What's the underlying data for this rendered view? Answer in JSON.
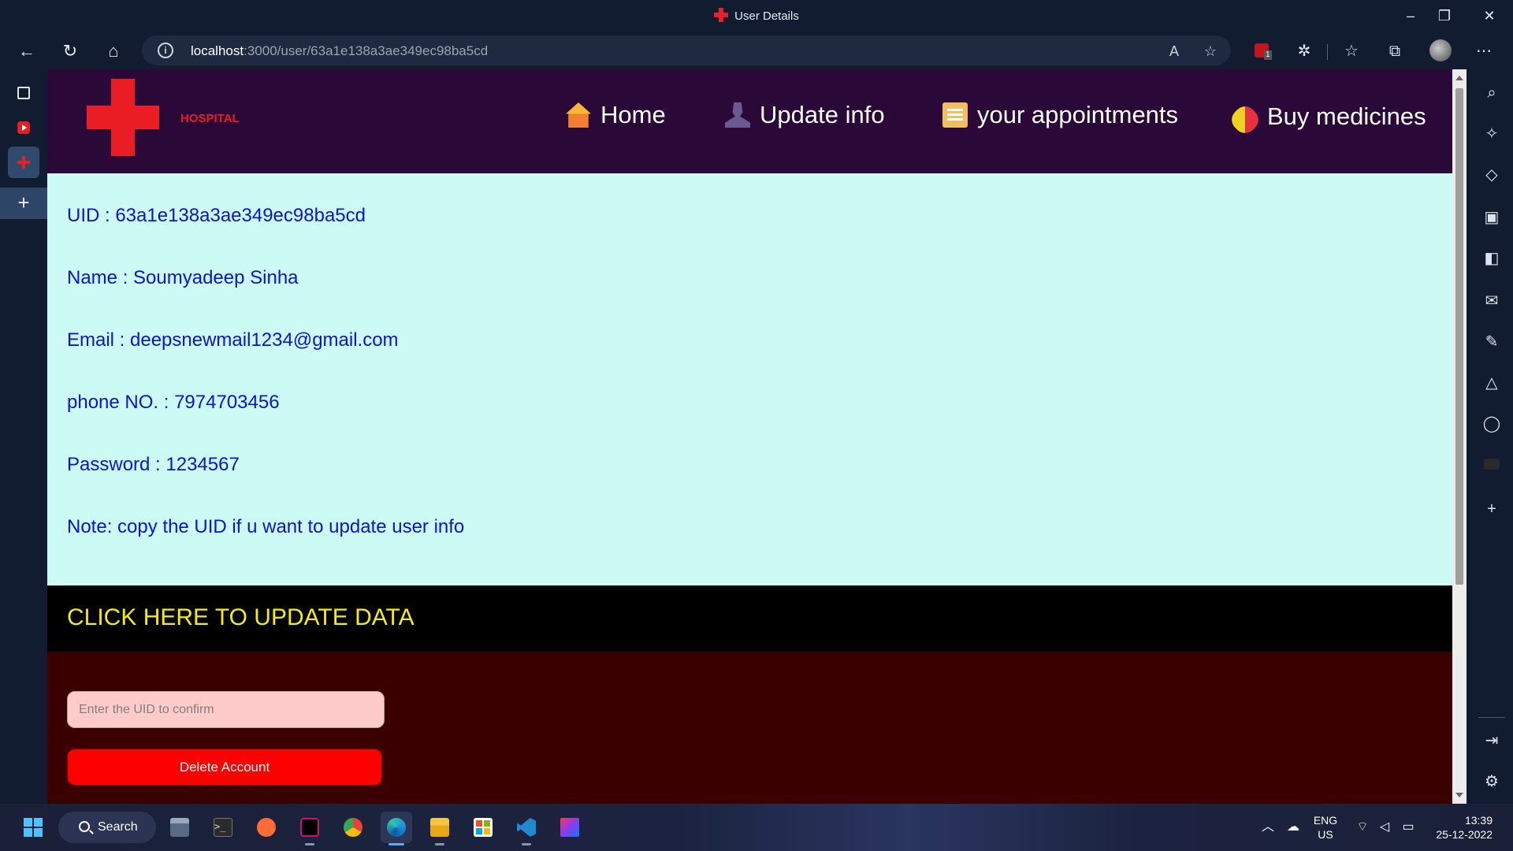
{
  "browser": {
    "tab_title": "User Details",
    "url_host": "localhost",
    "url_path": ":3000/user/63a1e138a3ae349ec98ba5cd"
  },
  "site": {
    "logo_text": "HOSPITAL",
    "nav": [
      {
        "label": "Home",
        "icon": "house-emoji"
      },
      {
        "label": "Update info",
        "icon": "person-silhouette-emoji"
      },
      {
        "label": "your appointments",
        "icon": "clipboard-emoji"
      },
      {
        "label": "Buy medicines",
        "icon": "pill-emoji"
      }
    ]
  },
  "user_info": {
    "uid": "UID : 63a1e138a3ae349ec98ba5cd",
    "name": "Name : Soumyadeep Sinha",
    "email": "Email : deepsnewmail1234@gmail.com",
    "phone": "phone NO. : 7974703456",
    "password": "Password : 1234567",
    "note": "Note: copy the UID if u want to update user info"
  },
  "update_bar": {
    "label": "CLICK HERE TO UPDATE DATA"
  },
  "delete_form": {
    "uid_placeholder": "Enter the UID to confirm",
    "uid_value": "",
    "delete_label": "Delete Account"
  },
  "taskbar": {
    "search_label": "Search",
    "language": "ENG",
    "region": "US",
    "time": "13:39",
    "date": "25-12-2022",
    "ublock_badge": "1"
  },
  "colors": {
    "header_bg": "#2a0838",
    "info_bg": "#ccfbf6",
    "info_text": "#1010dd",
    "update_bar_bg": "#000000",
    "update_bar_text": "#f2f000",
    "form_bg": "#3a0000",
    "delete_button": "#ff0000",
    "logo_red": "#ea1c24"
  }
}
